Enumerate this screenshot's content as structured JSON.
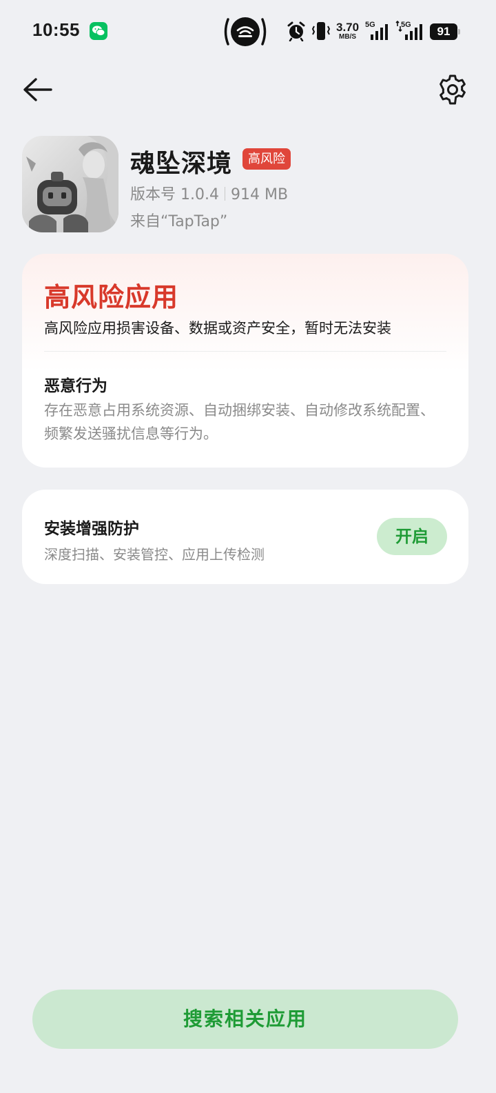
{
  "status_bar": {
    "time": "10:55",
    "net_speed_value": "3.70",
    "net_speed_unit": "MB/S",
    "signal1_label": "5G",
    "signal2_label": "5G",
    "battery": "91"
  },
  "app": {
    "name": "魂坠深境",
    "risk_badge": "高风险",
    "version": "版本号 1.0.4",
    "size": "914 MB",
    "source": "来自“TapTap”"
  },
  "risk_card": {
    "title": "高风险应用",
    "description": "高风险应用损害设备、数据或资产安全，暂时无法安装",
    "behavior_title": "恶意行为",
    "behavior_description": "存在恶意占用系统资源、自动捆绑安装、自动修改系统配置、频繁发送骚扰信息等行为。"
  },
  "protection_card": {
    "title": "安装增强防护",
    "description": "深度扫描、安装管控、应用上传检测",
    "button_label": "开启"
  },
  "bottom": {
    "search_button_label": "搜索相关应用"
  },
  "colors": {
    "background": "#eff0f3",
    "risk_red": "#d8392b",
    "badge_red": "#e0463a",
    "accent_green": "#1e9b35",
    "button_green_bg": "#cbe8d0"
  },
  "icons": [
    "wechat-icon",
    "hotspot-icon",
    "alarm-icon",
    "vibrate-icon",
    "signal-icon",
    "battery-icon",
    "back-arrow-icon",
    "gear-icon",
    "app-icon"
  ]
}
